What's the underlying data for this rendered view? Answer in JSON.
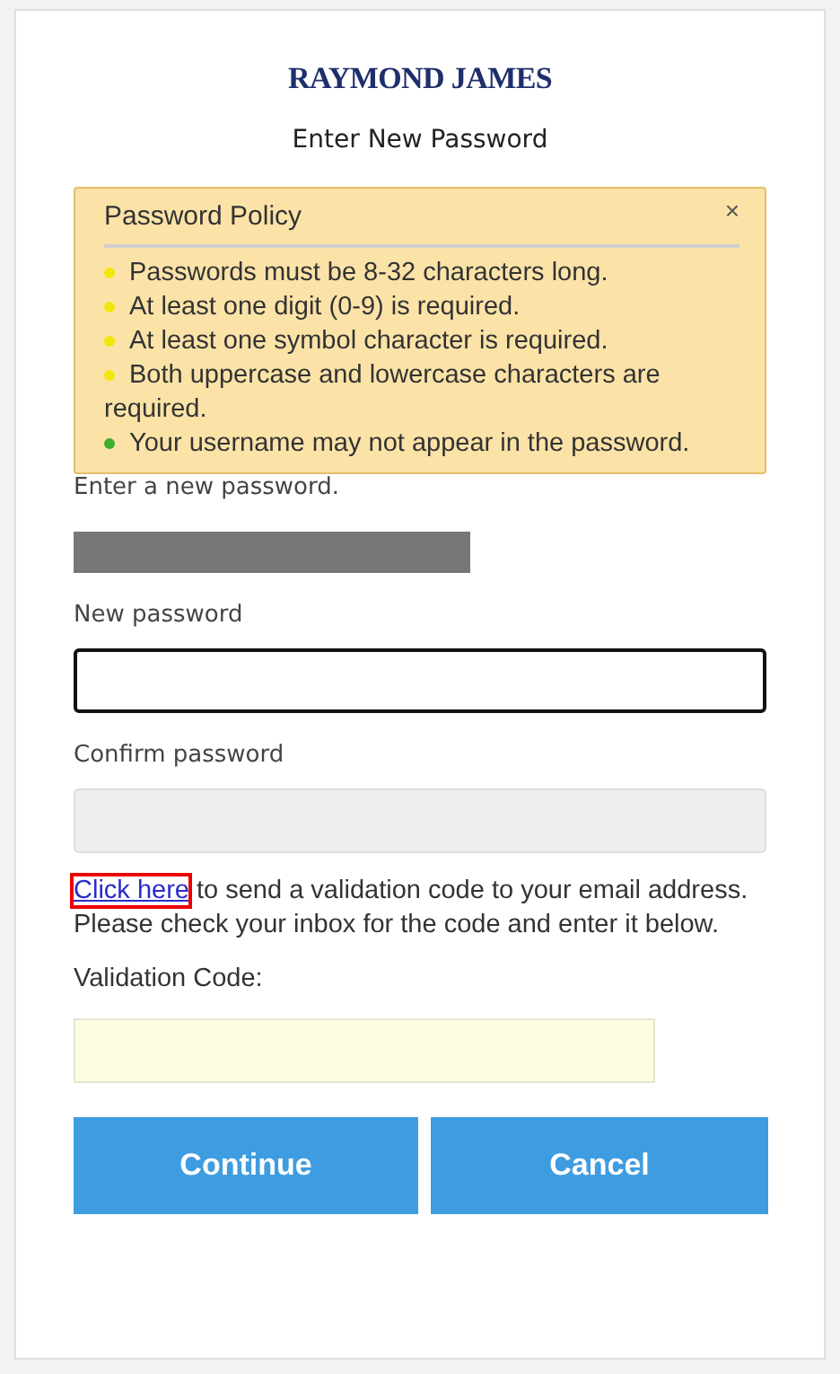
{
  "logo": "RAYMOND JAMES",
  "title": "Enter New Password",
  "policy": {
    "title": "Password Policy",
    "close": "×",
    "rules": [
      {
        "text": "Passwords must be 8-32 characters long.",
        "met": false
      },
      {
        "text": "At least one digit (0-9) is required.",
        "met": false
      },
      {
        "text": "At least one symbol character is required.",
        "met": false
      },
      {
        "text": "Both uppercase and lowercase characters are required.",
        "met": false
      },
      {
        "text": "Your username may not appear in the password.",
        "met": true
      }
    ]
  },
  "instruction": "Enter a new password.",
  "fields": [
    {
      "label": "New password",
      "focused": true,
      "disabled": false
    },
    {
      "label": "Confirm password",
      "focused": false,
      "disabled": true
    }
  ],
  "validation": {
    "link": "Click here",
    "text": " to send a validation code to your email address. Please check your inbox for the code and enter it below.",
    "label": "Validation Code:"
  },
  "buttons": [
    "Continue",
    "Cancel"
  ]
}
